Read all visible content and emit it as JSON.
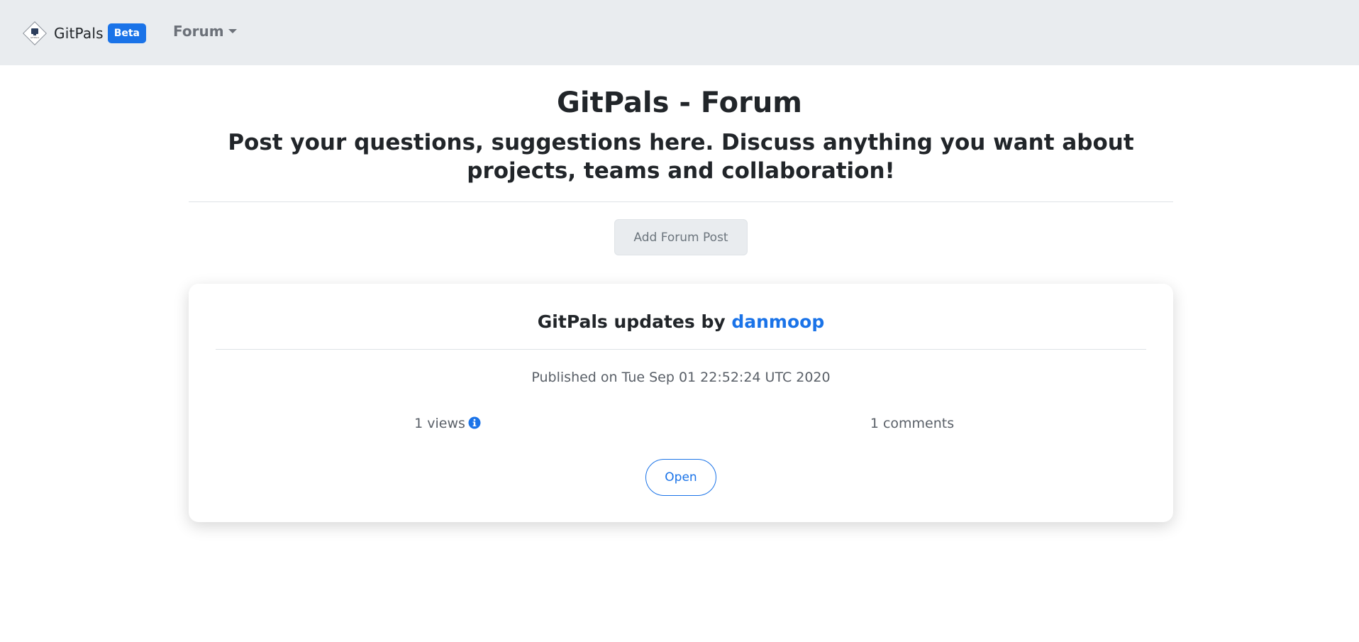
{
  "navbar": {
    "brand_name": "GitPals",
    "badge": "Beta",
    "forum_menu": "Forum",
    "logo_text": "GITPALS",
    "icons": {
      "logo": "gitpals-logo-icon",
      "caret": "chevron-down-icon"
    }
  },
  "header": {
    "title": "GitPals - Forum",
    "subtitle": "Post your questions, suggestions here. Discuss anything you want about projects, teams and collaboration!",
    "add_post_label": "Add Forum Post"
  },
  "posts": [
    {
      "title_prefix": "GitPals updates by",
      "author": "danmoop",
      "published": "Published on Tue Sep 01 22:52:24 UTC 2020",
      "views": "1 views",
      "comments": "1 comments",
      "open_label": "Open",
      "info_icon": "info-circle-icon"
    }
  ],
  "colors": {
    "accent": "#1a73e8",
    "navbar_bg": "#e9ecef",
    "text": "#212529",
    "muted": "#5a6068"
  }
}
